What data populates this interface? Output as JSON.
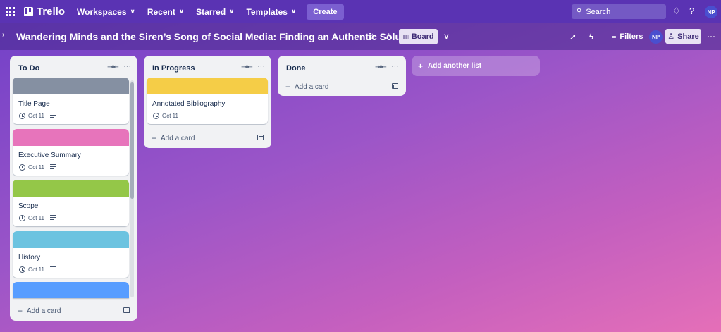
{
  "topbar": {
    "app_name": "Trello",
    "nav": [
      "Workspaces",
      "Recent",
      "Starred",
      "Templates"
    ],
    "create_label": "Create",
    "search_placeholder": "Search",
    "avatar_initials": "NP"
  },
  "board": {
    "title": "Wandering Minds and the Siren’s Song of Social Media: Finding an Authentic Solution",
    "view_label": "Board",
    "filters_label": "Filters",
    "share_label": "Share",
    "member_initials": "NP"
  },
  "lists": [
    {
      "name": "To Do",
      "cards": [
        {
          "title": "Title Page",
          "date": "Oct 11",
          "cover": "#8590a2"
        },
        {
          "title": "Executive Summary",
          "date": "Oct 11",
          "cover": "#e774bb"
        },
        {
          "title": "Scope",
          "date": "Oct 11",
          "cover": "#94c748"
        },
        {
          "title": "History",
          "date": "Oct 11",
          "cover": "#6cc3e0"
        },
        {
          "title": "",
          "date": "",
          "cover": "#579dff"
        }
      ],
      "add_card_label": "Add a card"
    },
    {
      "name": "In Progress",
      "cards": [
        {
          "title": "Annotated Bibliography",
          "date": "Oct 11",
          "cover": "#f5cd47"
        }
      ],
      "add_card_label": "Add a card"
    },
    {
      "name": "Done",
      "cards": [],
      "add_card_label": "Add a card"
    }
  ],
  "add_list_label": "Add another list"
}
